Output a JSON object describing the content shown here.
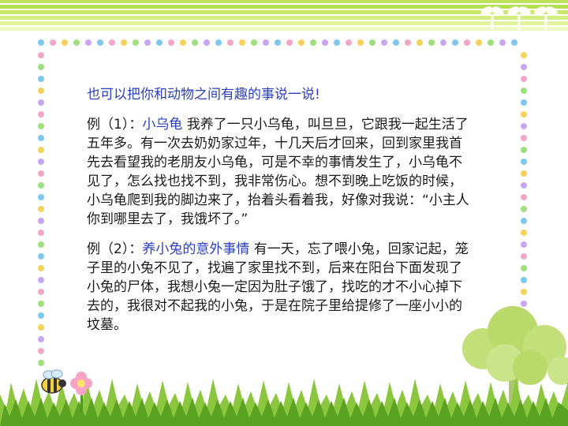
{
  "slide": {
    "intro": "也可以把你和动物之间有趣的事说一说!",
    "examples": [
      {
        "label": "例（1）：",
        "title": "小乌龟",
        "text": " 我养了一只小乌龟，叫旦旦，它跟我一起生活了五年多。有一次去奶奶家过年，十几天后才回来，回到家里我首先去看望我的老朋友小乌龟，可是不幸的事情发生了，小乌龟不见了，怎么找也找不到，我非常伤心。想不到晚上吃饭的时候，小乌龟爬到我的脚边来了，抬着头看着我，好像对我说：“小主人你到哪里去了，我饿坏了。”"
      },
      {
        "label": "例（2）：",
        "title": "养小兔的意外事情",
        "text": "  有一天，忘了喂小兔，回家记起，笼子里的小兔不见了，找遍了家里找不到，后来在阳台下面发现了小兔的尸体，我想小兔一定因为肚子饿了，找吃的才不小心掉下去的，我很对不起我的小兔，于是在院子里给提修了一座小小的坟墓。"
      }
    ]
  },
  "colors": {
    "highlight": "#2a3fbf",
    "body_text": "#1a1a1a",
    "stripe_green": "#bfe25a",
    "grass_green": "#6fb52a",
    "tree_green": "#b9d96a"
  },
  "decor": [
    "green-stripe-banner",
    "sprout-icon",
    "polka-dot-border",
    "grass",
    "tree-icon",
    "bee-icon",
    "flower-icon"
  ]
}
